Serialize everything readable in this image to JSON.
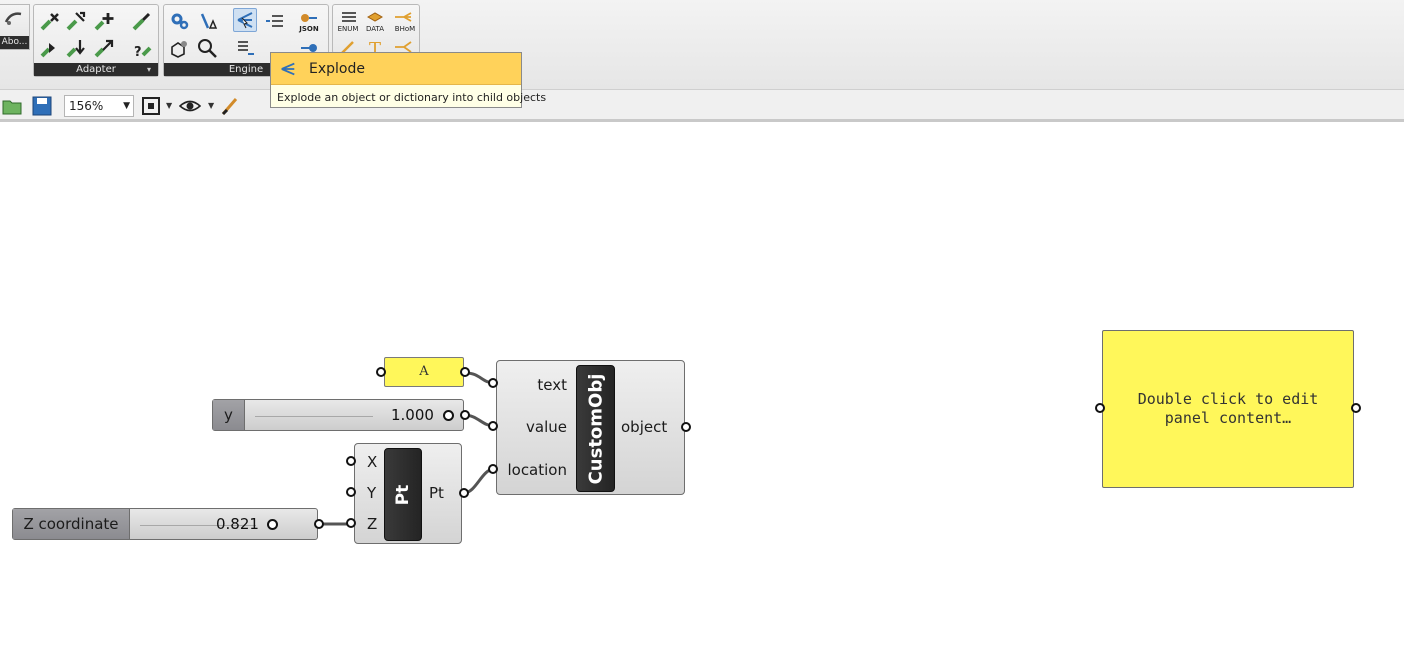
{
  "ribbon": {
    "about_label": "Abo...",
    "groups": [
      {
        "label": "Adapter"
      },
      {
        "label": "Engine"
      }
    ],
    "json_label": "JSON",
    "enum_label": "ENUM",
    "data_label": "DATA",
    "bhom_label": "BHoM"
  },
  "tooltip": {
    "title": "Explode",
    "description": "Explode an object or dictionary into child objects"
  },
  "canvas_toolbar": {
    "zoom_value": "156%"
  },
  "canvas": {
    "text_panel": {
      "value": "A"
    },
    "slider_y": {
      "name": "y",
      "value": "1.000"
    },
    "slider_z": {
      "name": "Z coordinate",
      "value": "0.821"
    },
    "custom_obj": {
      "title": "CustomObj",
      "inputs": [
        "text",
        "value",
        "location"
      ],
      "output": "object"
    },
    "point": {
      "title": "Pt",
      "inputs": [
        "X",
        "Y",
        "Z"
      ],
      "output": "Pt"
    },
    "note_panel": {
      "text": "Double click to edit panel content…"
    }
  },
  "colors": {
    "panel_yellow": "#fff75a",
    "tooltip_header": "#ffd25a",
    "component_dark": "#2a2a2a"
  }
}
